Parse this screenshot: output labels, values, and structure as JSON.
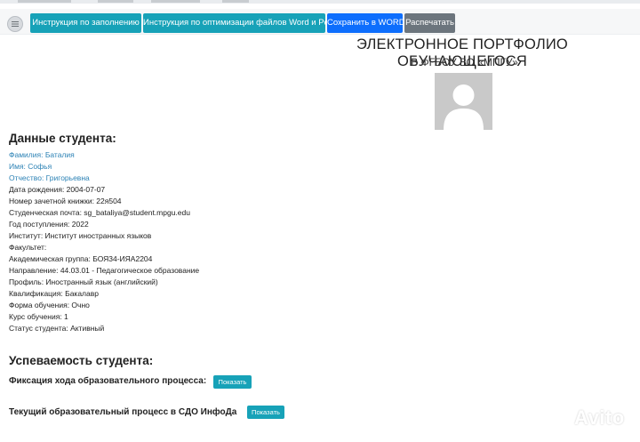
{
  "toolbar": {
    "buttons": [
      {
        "label": "Инструкция по заполнению"
      },
      {
        "label": "Инструкция по оптимизации файлов Word и Pdf"
      },
      {
        "label": "Сохранить в WORD"
      },
      {
        "label": "Распечатать"
      }
    ]
  },
  "header": {
    "title": "ЭЛЕКТРОННОЕ ПОРТФОЛИО ОБУЧАЮЩЕГОСЯ",
    "subtitle": "В ФГБОУ ВО «МПГУ»"
  },
  "student": {
    "section_title": "Данные студента:",
    "fields": [
      "Фамилия: Баталия",
      "Имя: Софья",
      "Отчество: Григорьевна",
      "Дата рождения: 2004-07-07",
      "Номер зачетной книжки: 22я504",
      "Студенческая почта: sg_bataliya@student.mpgu.edu",
      "Год поступления: 2022",
      "Институт: Институт иностранных языков",
      "Факультет:",
      "Академическая группа: БОЯ34-ИЯА2204",
      "Направление: 44.03.01 - Педагогическое образование",
      "Профиль: Иностранный язык (английский)",
      "Квалификация: Бакалавр",
      "Форма обучения: Очно",
      "Курс обучения: 1",
      "Статус студента: Активный"
    ]
  },
  "performance": {
    "section_title": "Успеваемость студента:",
    "rows": [
      {
        "label": "Фиксация хода образовательного процесса:",
        "button": "Показать"
      },
      {
        "label": "Текущий образовательный процесс в СДО ИнфоДа",
        "button": "Показать"
      }
    ]
  },
  "watermark": {
    "text": "Avito"
  },
  "colors": {
    "teal": "#17a2b8",
    "blue": "#0d6efd",
    "gray": "#6c757d",
    "link": "#2c82b5"
  }
}
